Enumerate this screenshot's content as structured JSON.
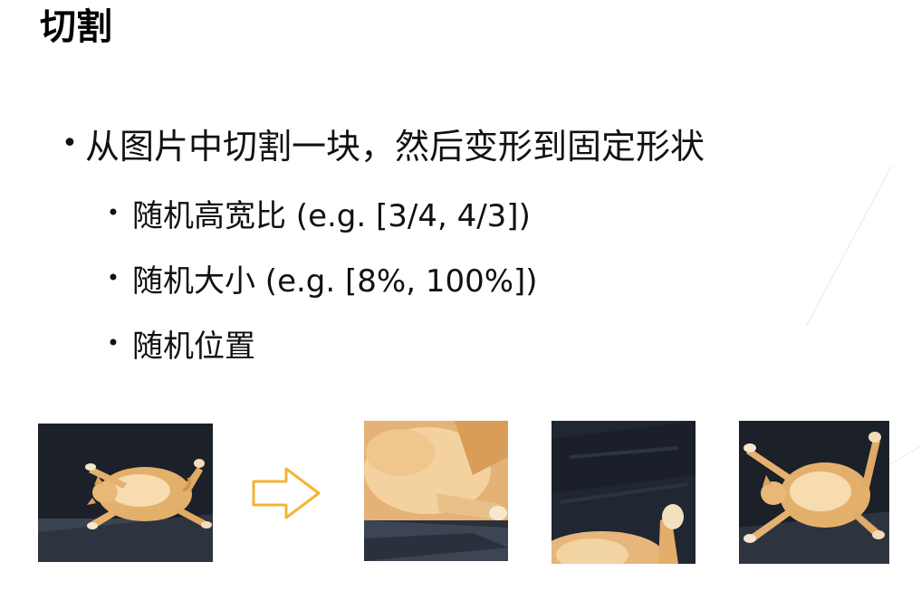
{
  "slide": {
    "title": "切割"
  },
  "bullets": {
    "main": {
      "marker": "•",
      "text": "从图片中切割一块，然后变形到固定形状"
    },
    "sub": [
      {
        "marker": "•",
        "text": "随机高宽比 (e.g. [3/4, 4/3])"
      },
      {
        "marker": "•",
        "text": "随机大小 (e.g. [8%, 100%])"
      },
      {
        "marker": "•",
        "text": "随机位置"
      }
    ]
  },
  "images": {
    "arrow_color": "#f5b335",
    "subject": "orange-tabby-cat-on-dark-blanket"
  }
}
